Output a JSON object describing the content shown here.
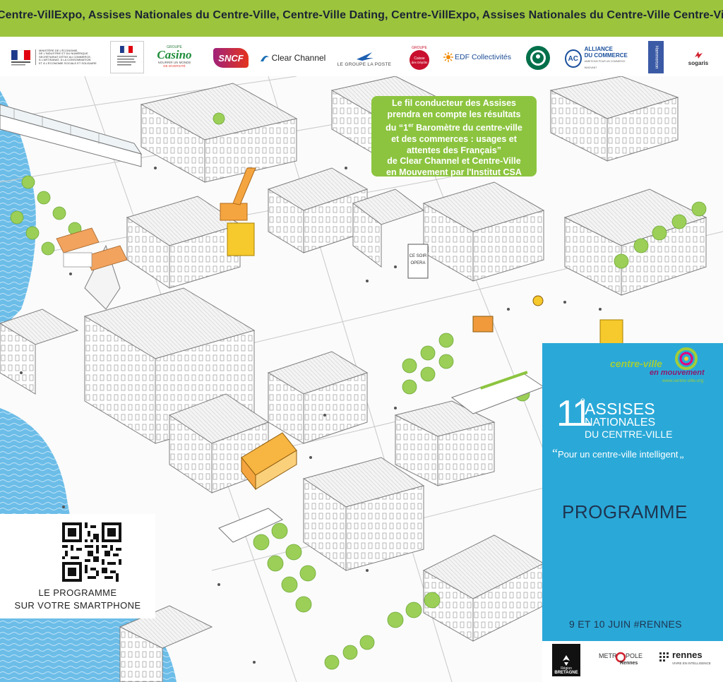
{
  "banner": {
    "text": "Centre-VillExpo, Assises Nationales du Centre-Ville, Centre-Ville Dating, Centre-VillExpo, Assises Nationales du Centre-Ville Centre-Ville Dating, Ce"
  },
  "partners": {
    "ministere_line1": "MINISTÈRE DE L'ÉCONOMIE,",
    "ministere_line2": "DE L'INDUSTRIE ET DU NUMÉRIQUE",
    "ministere_line3": "SECRÉTARIAT D'ÉTAT AU COMMERCE,",
    "ministere_line4": "À L'ARTISANAT, À LA CONSOMMATION",
    "ministere_line5": "ET À L'ÉCONOMIE SOCIALE ET SOLIDAIRE",
    "casino_group": "GROUPE",
    "casino": "Casino",
    "casino_tag1": "NOURRIR UN MONDE",
    "casino_tag2": "DE DIVERSITÉ",
    "sncf": "SNCF",
    "clear_channel": "Clear Channel",
    "la_poste": "LE GROUPE LA POSTE",
    "cdc_group": "GROUPE",
    "cdc1": "Caisse",
    "cdc2": "des Dépôts",
    "edf": "EDF Collectivités",
    "alliance1": "ALLIANCE",
    "alliance2": "DU COMMERCE",
    "alliance_tag": "AMBITIONS POUR UN COMMERCE INNOVANT",
    "hammerson": "Hammerson",
    "sogaris": "sogaris"
  },
  "callout": {
    "line1": "Le fil conducteur des Assises",
    "line2": "prendra en compte les résultats",
    "line3a": "du “1",
    "line3sup": "er",
    "line3b": " Baromètre du centre-ville",
    "line4": "et des commerces : usages et",
    "line5": "attentes des Français”",
    "line6": "de Clear Channel et Centre-Ville",
    "line7": "en Mouvement par l'Institut CSA"
  },
  "event": {
    "org_name": "centre-ville",
    "org_name2": "en mouvement",
    "org_url": "www.centre-ville.org",
    "number": "11",
    "number_sup": "e",
    "title1": "ASSISES",
    "title2": "NATIONALES",
    "title3": "DU CENTRE-VILLE",
    "open_quote": "“",
    "tagline": "Pour un centre-ville intelligent",
    "close_quote": "„",
    "heading": "PROGRAMME",
    "dates": "9 ET 10 JUIN #RENNES"
  },
  "map_signs": {
    "sign1": "CE SOIR",
    "sign2": "OPERA"
  },
  "qr": {
    "line1": "LE PROGRAMME",
    "line2": "SUR VOTRE SMARTPHONE"
  },
  "footer": {
    "region": "Région",
    "region2": "BRETAGNE",
    "metropole_a": "METR",
    "metropole_b": "POLE",
    "metropole_c": "Rennes",
    "rennes": "rennes",
    "rennes_tag": "VIVRE EN INTELLIGENCE"
  },
  "colors": {
    "banner_green": "#9cc53d",
    "callout_green": "#8cc43f",
    "panel_blue": "#2aa9d8",
    "water_blue": "#5fb8e6"
  }
}
